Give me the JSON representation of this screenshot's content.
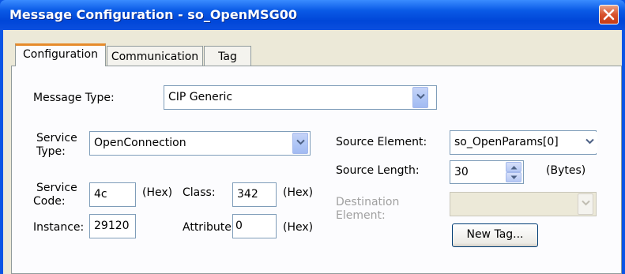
{
  "window": {
    "title": "Message Configuration - so_OpenMSG00",
    "close_icon": "close-icon"
  },
  "tabs": [
    {
      "label": "Configuration",
      "active": true
    },
    {
      "label": "Communication",
      "active": false
    },
    {
      "label": "Tag",
      "active": false
    }
  ],
  "config": {
    "message_type_label": "Message Type:",
    "message_type_value": "CIP Generic",
    "service_type_label_1": "Service",
    "service_type_label_2": "Type:",
    "service_type_value": "OpenConnection",
    "service_code_label_1": "Service",
    "service_code_label_2": "Code:",
    "service_code_value": "4c",
    "hex_label": "(Hex)",
    "class_label": "Class:",
    "class_value": "342",
    "instance_label": "Instance:",
    "instance_value": "29120",
    "attribute_label": "Attribute:",
    "attribute_value": "0",
    "source_element_label": "Source Element:",
    "source_element_value": "so_OpenParams[0]",
    "source_length_label": "Source Length:",
    "source_length_value": "30",
    "bytes_label": "(Bytes)",
    "destination_label_1": "Destination",
    "destination_label_2": "Element:",
    "destination_value": "",
    "new_tag_label": "New Tag..."
  },
  "colors": {
    "title_bar": "#0a5ae6",
    "active_tab_accent": "#e68b2c",
    "close_button": "#d8522c"
  }
}
